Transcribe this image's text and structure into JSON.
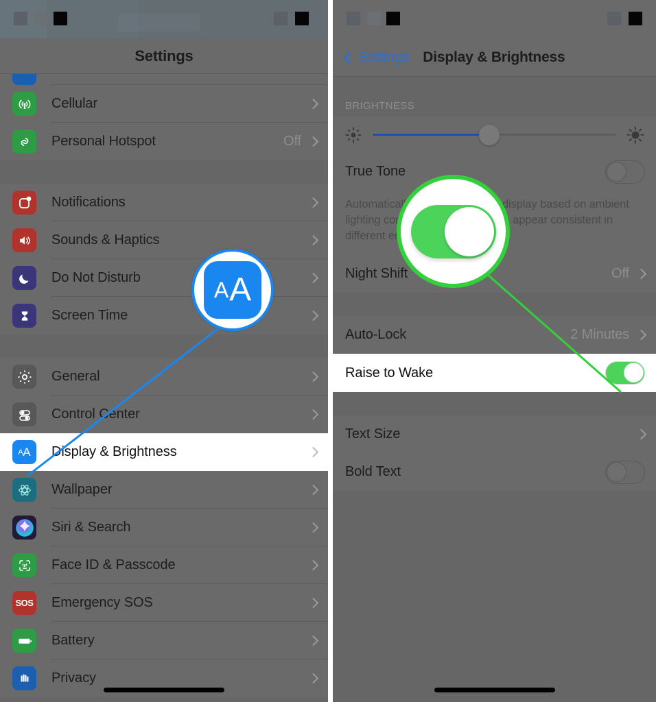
{
  "left_phone": {
    "nav_title": "Settings",
    "partial_top_row_label": "",
    "items": [
      {
        "label": "Cellular",
        "value": "",
        "icon": "cellular-icon",
        "color": "#2e9b45"
      },
      {
        "label": "Personal Hotspot",
        "value": "Off",
        "icon": "hotspot-icon",
        "color": "#2e9b45"
      },
      {
        "label": "Notifications",
        "value": "",
        "icon": "notifications-icon",
        "color": "#b0342c"
      },
      {
        "label": "Sounds & Haptics",
        "value": "",
        "icon": "sounds-icon",
        "color": "#b0342c"
      },
      {
        "label": "Do Not Disturb",
        "value": "",
        "icon": "moon-icon",
        "color": "#3b3579"
      },
      {
        "label": "Screen Time",
        "value": "",
        "icon": "hourglass-icon",
        "color": "#3b3579"
      },
      {
        "label": "General",
        "value": "",
        "icon": "gear-icon",
        "color": "#585858"
      },
      {
        "label": "Control Center",
        "value": "",
        "icon": "control-center-icon",
        "color": "#585858"
      },
      {
        "label": "Display & Brightness",
        "value": "",
        "icon": "display-brightness-icon",
        "color": "#1a86f0"
      },
      {
        "label": "Wallpaper",
        "value": "",
        "icon": "wallpaper-icon",
        "color": "#1d6d80"
      },
      {
        "label": "Siri & Search",
        "value": "",
        "icon": "siri-icon",
        "color": "#231a3a"
      },
      {
        "label": "Face ID & Passcode",
        "value": "",
        "icon": "face-id-icon",
        "color": "#2e9b45"
      },
      {
        "label": "Emergency SOS",
        "value": "",
        "icon": "sos-icon",
        "color": "#b0342c"
      },
      {
        "label": "Battery",
        "value": "",
        "icon": "battery-icon",
        "color": "#2e9b45"
      },
      {
        "label": "Privacy",
        "value": "",
        "icon": "privacy-hand-icon",
        "color": "#1a5fb0"
      }
    ],
    "callout": {
      "kind": "magnifier",
      "magnified_icon": "display-brightness-icon",
      "magnified_letters_small": "A",
      "magnified_letters_big": "A",
      "accent": "#1a86f0"
    }
  },
  "right_phone": {
    "back_label": "Settings",
    "nav_title": "Display & Brightness",
    "brightness": {
      "section_header": "BRIGHTNESS",
      "slider_percent": 48,
      "low_icon": "brightness-low-icon",
      "high_icon": "brightness-high-icon"
    },
    "true_tone": {
      "label": "True Tone",
      "state": "off",
      "description": "Automatically adapt the iPhone display based on ambient lighting conditions to make colors appear consistent in different environments."
    },
    "night_shift": {
      "label": "Night Shift",
      "value": "Off"
    },
    "auto_lock": {
      "label": "Auto-Lock",
      "value": "2 Minutes"
    },
    "raise_to_wake": {
      "label": "Raise to Wake",
      "state": "on"
    },
    "text_size": {
      "label": "Text Size",
      "value": ""
    },
    "bold_text": {
      "label": "Bold Text",
      "state": "off"
    },
    "callout": {
      "kind": "magnifier",
      "magnified_control": "true-tone-toggle",
      "magnified_state": "on",
      "accent": "#34d03c"
    }
  },
  "colors": {
    "ios_blue": "#1a86f0",
    "ios_green": "#4cd45a",
    "callout_green": "#34d03c",
    "dim_background": "#666666",
    "highlight_row": "#ffffff"
  }
}
